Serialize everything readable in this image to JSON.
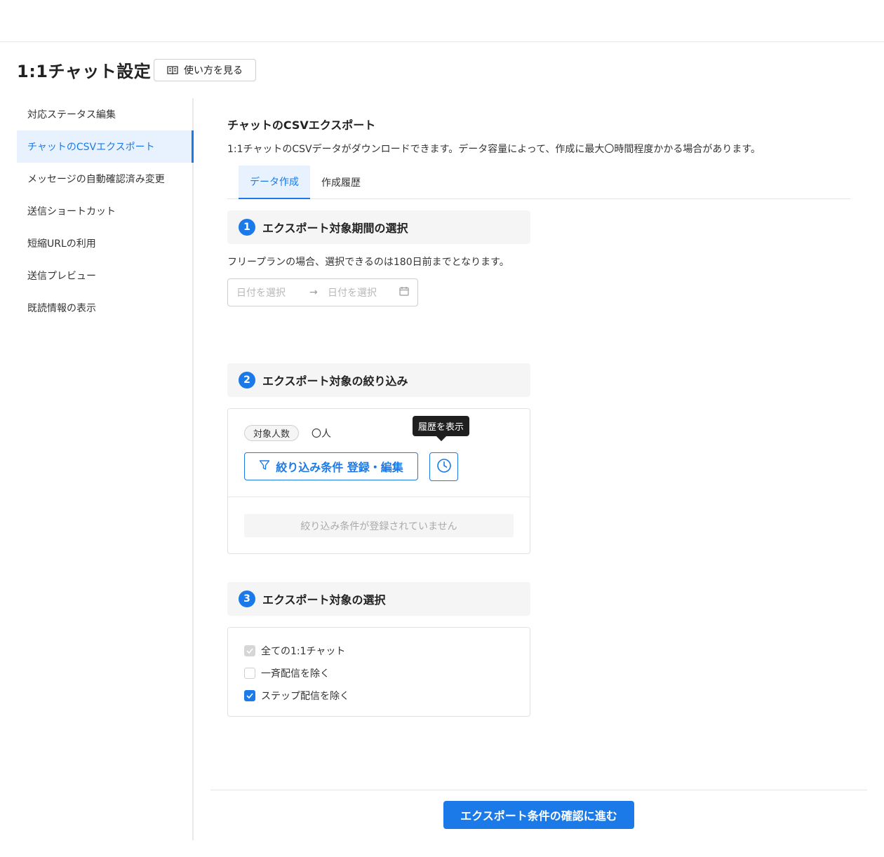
{
  "header": {
    "title": "1:1チャット設定",
    "howto_label": "使い方を見る"
  },
  "sidebar": {
    "items": [
      {
        "label": "対応ステータス編集"
      },
      {
        "label": "チャットのCSVエクスポート"
      },
      {
        "label": "メッセージの自動確認済み変更"
      },
      {
        "label": "送信ショートカット"
      },
      {
        "label": "短縮URLの利用"
      },
      {
        "label": "送信プレビュー"
      },
      {
        "label": "既読情報の表示"
      }
    ]
  },
  "main": {
    "title": "チャットのCSVエクスポート",
    "description": "1:1チャットのCSVデータがダウンロードできます。データ容量によって、作成に最大〇時間程度かかる場合があります。",
    "tabs": [
      {
        "label": "データ作成"
      },
      {
        "label": "作成履歴"
      }
    ],
    "sections": [
      {
        "number": "1",
        "label": "エクスポート対象期間の選択"
      },
      {
        "number": "2",
        "label": "エクスポート対象の絞り込み"
      },
      {
        "number": "3",
        "label": "エクスポート対象の選択"
      }
    ],
    "period": {
      "note": "フリープランの場合、選択できるのは180日前までとなります。",
      "start_placeholder": "日付を選択",
      "arrow": "→",
      "end_placeholder": "日付を選択"
    },
    "filter": {
      "count_label": "対象人数",
      "count_value": "〇人",
      "tooltip": "履歴を表示",
      "button_label": "絞り込み条件 登録・編集",
      "empty_message": "絞り込み条件が登録されていません"
    },
    "targets": [
      {
        "label": "全ての1:1チャット",
        "state": "checked-disabled"
      },
      {
        "label": "一斉配信を除く",
        "state": "unchecked"
      },
      {
        "label": "ステップ配信を除く",
        "state": "checked"
      }
    ]
  },
  "footer": {
    "submit_label": "エクスポート条件の確認に進む"
  },
  "colors": {
    "accent": "#1c7ae8",
    "active_bg": "#e8f2fe",
    "section_bg": "#f5f5f5"
  }
}
